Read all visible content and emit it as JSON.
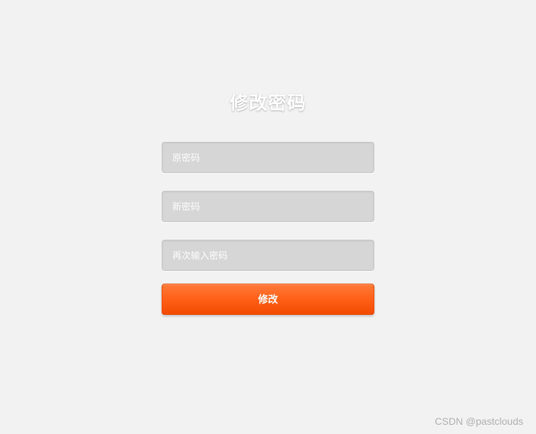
{
  "form": {
    "title": "修改密码",
    "old_password": {
      "placeholder": "原密码",
      "value": ""
    },
    "new_password": {
      "placeholder": "新密码",
      "value": ""
    },
    "confirm_password": {
      "placeholder": "再次输入密码",
      "value": ""
    },
    "submit_label": "修改"
  },
  "watermark": "CSDN @pastclouds"
}
